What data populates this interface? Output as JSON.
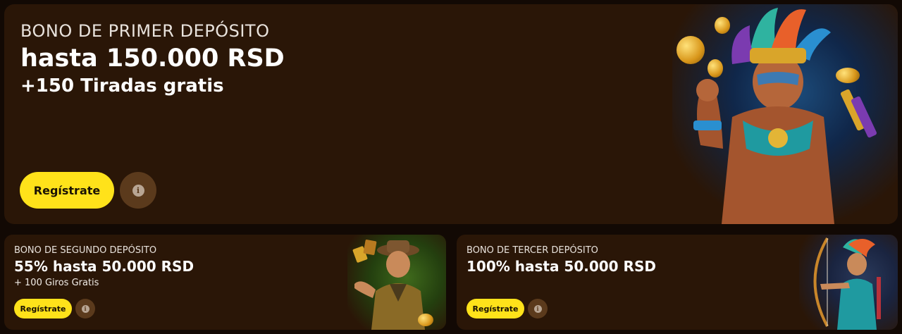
{
  "hero": {
    "kicker": "BONO DE PRIMER DEPÓSITO",
    "title": "hasta 150.000 RSD",
    "subtitle": "+150 Tiradas gratis",
    "register_label": "Regístrate",
    "info_glyph": "i",
    "art_icon": "aztec-warrior-illustration"
  },
  "cards": [
    {
      "kicker": "BONO DE SEGUNDO DEPÓSITO",
      "title": "55% hasta 50.000 RSD",
      "subtitle": "+ 100 Giros Gratis",
      "register_label": "Regístrate",
      "info_glyph": "i",
      "art_icon": "explorer-illustration"
    },
    {
      "kicker": "BONO DE TERCER DEPÓSITO",
      "title": "100% hasta 50.000 RSD",
      "register_label": "Regístrate",
      "info_glyph": "i",
      "art_icon": "archer-illustration"
    }
  ],
  "colors": {
    "accent_yellow": "#ffe21a",
    "panel_bg": "#2a1607",
    "page_bg": "#120904",
    "info_bg": "#5b3a1c"
  }
}
